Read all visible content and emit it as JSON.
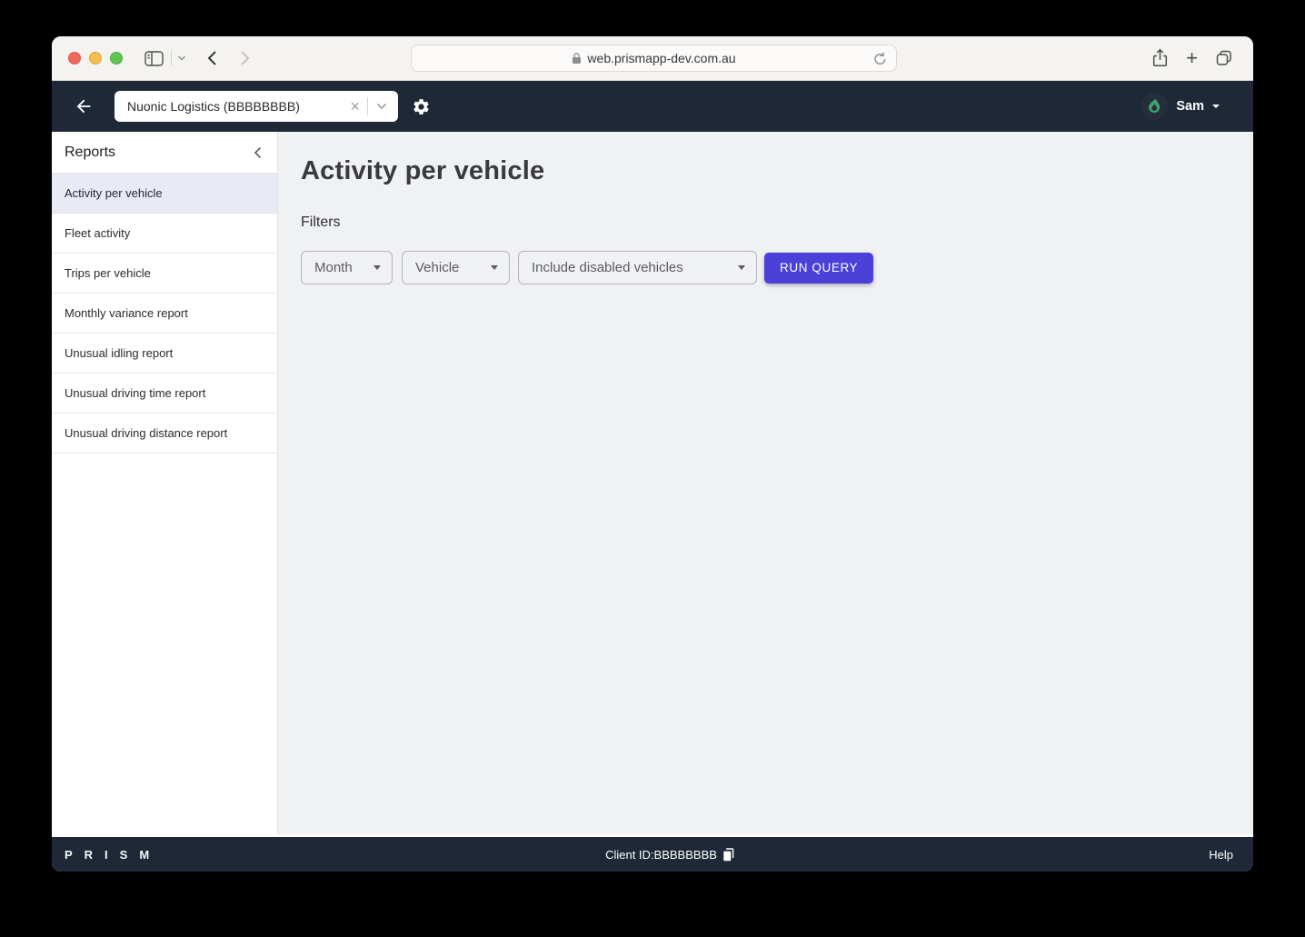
{
  "browser": {
    "url": "web.prismapp-dev.com.au",
    "icons": {
      "traffic_lights": [
        "close",
        "minimize",
        "zoom"
      ],
      "left": [
        "sidebar-toggle-icon",
        "chevron-down-icon",
        "back-icon",
        "forward-icon"
      ],
      "url_field": [
        "lock-icon",
        "reload-icon"
      ],
      "right": [
        "share-icon",
        "new-tab-icon",
        "tab-overview-icon"
      ]
    }
  },
  "navbar": {
    "back_icon": "arrow-left-icon",
    "client_picker_value": "Nuonic Logistics (BBBBBBBB)",
    "settings_icon": "gear-icon",
    "user_name": "Sam",
    "avatar_icon": "flame-icon"
  },
  "sidebar": {
    "title": "Reports",
    "collapse_icon": "chevron-left-icon",
    "items": [
      {
        "label": "Activity per vehicle",
        "selected": true
      },
      {
        "label": "Fleet activity",
        "selected": false
      },
      {
        "label": "Trips per vehicle",
        "selected": false
      },
      {
        "label": "Monthly variance report",
        "selected": false
      },
      {
        "label": "Unusual idling report",
        "selected": false
      },
      {
        "label": "Unusual driving time report",
        "selected": false
      },
      {
        "label": "Unusual driving distance report",
        "selected": false
      }
    ]
  },
  "main": {
    "title": "Activity per vehicle",
    "filters_label": "Filters",
    "filters": [
      {
        "label": "Month"
      },
      {
        "label": "Vehicle"
      },
      {
        "label": "Include disabled vehicles"
      }
    ],
    "run_query_label": "RUN QUERY"
  },
  "footer": {
    "brand": "PRISM",
    "client_id": "Client ID:BBBBBBBB",
    "copy_icon": "copy-icon",
    "help": "Help"
  },
  "colors": {
    "chrome_dark": "#1e2836",
    "accent_button": "#4b40d8",
    "selected_item_bg": "#e8eaf6",
    "flame_green": "#3ca06b",
    "page_bg": "#f0f1f3",
    "sidebar_bg": "#ffffff"
  }
}
